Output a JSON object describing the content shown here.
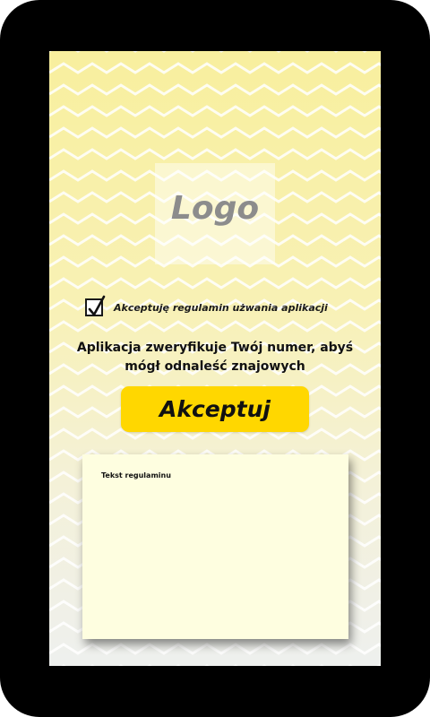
{
  "logo": {
    "text": "Logo"
  },
  "terms_consent": {
    "label": "Akceptuję regulamin użwania aplikacji",
    "checked": true
  },
  "verify_message": "Aplikacja zweryfikuje Twój numer, abyś mógł odnaleść znajowych",
  "accept_button": {
    "label": "Akceptuj"
  },
  "terms_panel": {
    "text": "Tekst regulaminu"
  },
  "colors": {
    "frame": "#000000",
    "background_top": "#f8ef9e",
    "background_bottom": "#eef0ee",
    "chevron": "#ffffff",
    "button": "#ffd700",
    "panel": "#fefee0",
    "text": "#111111",
    "logo_text": "#8c8c8c"
  },
  "icons": {
    "checkbox": "checkmark-icon"
  }
}
